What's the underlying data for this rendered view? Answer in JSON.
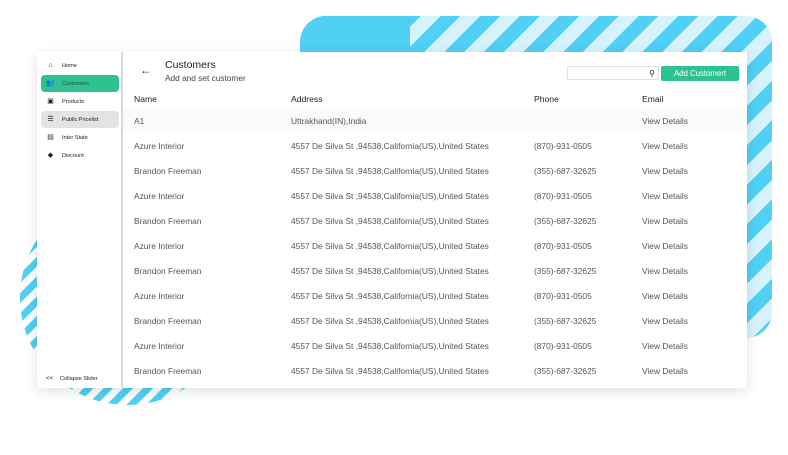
{
  "sidebar": {
    "items": [
      {
        "label": "Home",
        "icon": "home-icon",
        "glyph": "⌂"
      },
      {
        "label": "Customers",
        "icon": "users-icon",
        "glyph": "👥"
      },
      {
        "label": "Products",
        "icon": "box-icon",
        "glyph": "▣"
      },
      {
        "label": "Public Pricelist",
        "icon": "list-icon",
        "glyph": "☰"
      },
      {
        "label": "Inter State",
        "icon": "book-icon",
        "glyph": "▤"
      },
      {
        "label": "Discount",
        "icon": "tag-icon",
        "glyph": "◆"
      }
    ],
    "collapse_label": "Collapse Slider",
    "collapse_glyph": "<<"
  },
  "header": {
    "back_glyph": "←",
    "title": "Customers",
    "subtitle": "Add and set customer",
    "search_placeholder": "",
    "search_glyph": "⚲",
    "add_label": "Add Customert"
  },
  "table": {
    "headers": [
      "Name",
      "Address",
      "Phone",
      "Email"
    ],
    "rows": [
      [
        "A1",
        "Uttrakhand(IN),India",
        "",
        "View Details"
      ],
      [
        "Azure Interior",
        "4557 De Silva St ,94538,California(US),United States",
        "(870)-931-0505",
        "View Details"
      ],
      [
        "Brandon Freeman",
        "4557 De Silva St ,94538,California(US),United States",
        "(355)-687-32625",
        "View Details"
      ],
      [
        "Azure Interior",
        "4557 De Silva St ,94538,California(US),United States",
        "(870)-931-0505",
        "View Details"
      ],
      [
        "Brandon Freeman",
        "4557 De Silva St ,94538,California(US),United States",
        "(355)-687-32625",
        "View Details"
      ],
      [
        "Azure Interior",
        "4557 De Silva St ,94538,California(US),United States",
        "(870)-931-0505",
        "View Details"
      ],
      [
        "Brandon Freeman",
        "4557 De Silva St ,94538,California(US),United States",
        "(355)-687-32625",
        "View Details"
      ],
      [
        "Azure Interior",
        "4557 De Silva St ,94538,California(US),United States",
        "(870)-931-0505",
        "View Details"
      ],
      [
        "Brandon Freeman",
        "4557 De Silva St ,94538,California(US),United States",
        "(355)-687-32625",
        "View Details"
      ],
      [
        "Azure Interior",
        "4557 De Silva St ,94538,California(US),United States",
        "(870)-931-0505",
        "View Details"
      ],
      [
        "Brandon Freeman",
        "4557 De Silva St ,94538,California(US),United States",
        "(355)-687-32625",
        "View Details"
      ]
    ]
  },
  "colors": {
    "accent": "#2ec292",
    "decor": "#4fd0f4"
  }
}
